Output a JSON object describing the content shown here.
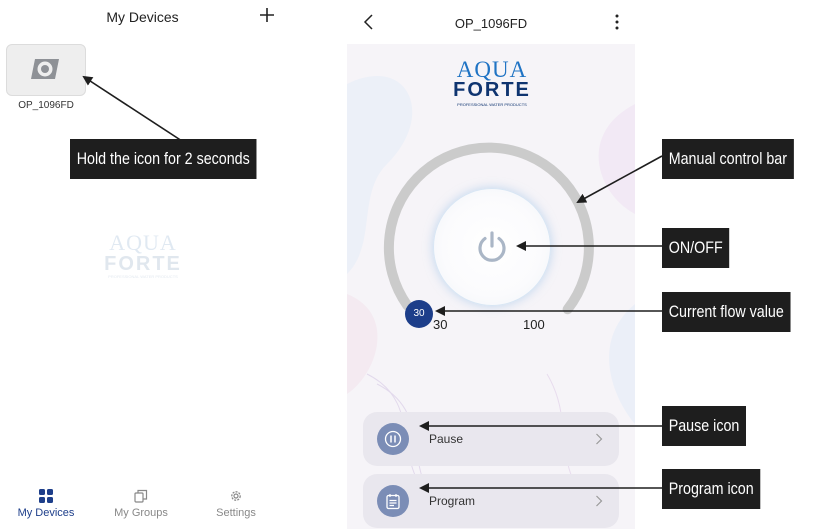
{
  "left_screen": {
    "title": "My Devices",
    "device": {
      "name": "OP_1096FD"
    },
    "logo": {
      "line1": "AQUA",
      "line2": "FORTE",
      "tagline": "PROFESSIONAL WATER PRODUCTS"
    },
    "nav": [
      {
        "label": "My Devices",
        "icon": "grid-icon",
        "active": true
      },
      {
        "label": "My Groups",
        "icon": "groups-icon",
        "active": false
      },
      {
        "label": "Settings",
        "icon": "gear-icon",
        "active": false
      }
    ]
  },
  "right_screen": {
    "title": "OP_1096FD",
    "logo": {
      "line1": "AQUA",
      "line2": "FORTE",
      "tagline": "PROFESSIONAL WATER PRODUCTS"
    },
    "flow": {
      "current": "30",
      "min_label": "30",
      "max_label": "100",
      "level_fraction": 0.0
    },
    "rows": [
      {
        "label": "Pause",
        "icon": "pause-icon"
      },
      {
        "label": "Program",
        "icon": "calendar-icon"
      }
    ]
  },
  "callouts": {
    "hold": "Hold the icon for 2 seconds",
    "manual": "Manual control bar",
    "onoff": "ON/OFF",
    "flow": "Current flow value",
    "pause": "Pause icon",
    "program": "Program icon"
  },
  "colors": {
    "accent": "#1d3e8a",
    "callout_bg": "#1e1e1e",
    "row_bg": "#e9e7ee",
    "icon_circle": "#7b8db6",
    "logo_blue": "#1f73c4",
    "logo_navy": "#0f3470"
  }
}
